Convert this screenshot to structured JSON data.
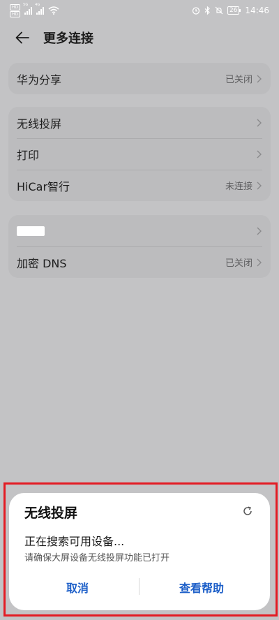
{
  "status_bar": {
    "badges": [
      "HD",
      "HD"
    ],
    "network_1": "5G",
    "network_2": "4G",
    "battery": "26",
    "time": "14:46",
    "icons": [
      "alarm-icon",
      "bluetooth-icon",
      "mute-icon",
      "battery-icon",
      "wifi-icon"
    ]
  },
  "header": {
    "title": "更多连接",
    "back_icon": "back-arrow-icon"
  },
  "groups": [
    {
      "items": [
        {
          "label": "华为分享",
          "value": "已关闭"
        }
      ]
    },
    {
      "items": [
        {
          "label": "无线投屏",
          "value": ""
        },
        {
          "label": "打印",
          "value": ""
        },
        {
          "label": "HiCar智行",
          "value": "未连接"
        }
      ]
    },
    {
      "items": [
        {
          "label": "",
          "value": ""
        },
        {
          "label": "加密 DNS",
          "value": "已关闭"
        }
      ]
    }
  ],
  "dialog": {
    "title": "无线投屏",
    "status": "正在搜索可用设备...",
    "hint": "请确保大屏设备无线投屏功能已打开",
    "cancel": "取消",
    "help": "查看帮助",
    "refresh_icon": "loading-icon"
  },
  "colors": {
    "accent": "#1d5fc8",
    "highlight": "#e31b23",
    "background": "#c3c3c5"
  }
}
